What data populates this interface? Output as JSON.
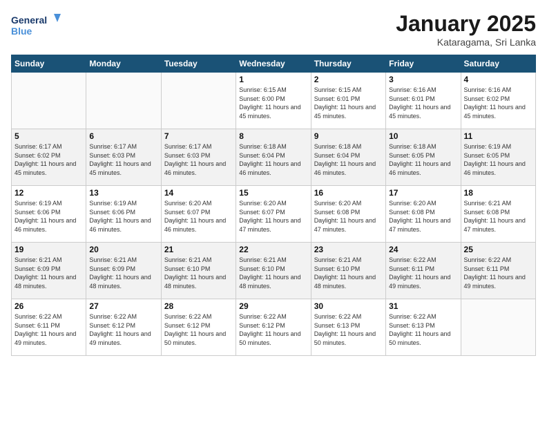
{
  "logo": {
    "line1": "General",
    "line2": "Blue"
  },
  "header": {
    "month": "January 2025",
    "location": "Kataragama, Sri Lanka"
  },
  "weekdays": [
    "Sunday",
    "Monday",
    "Tuesday",
    "Wednesday",
    "Thursday",
    "Friday",
    "Saturday"
  ],
  "weeks": [
    [
      {
        "day": "",
        "sunrise": "",
        "sunset": "",
        "daylight": ""
      },
      {
        "day": "",
        "sunrise": "",
        "sunset": "",
        "daylight": ""
      },
      {
        "day": "",
        "sunrise": "",
        "sunset": "",
        "daylight": ""
      },
      {
        "day": "1",
        "sunrise": "Sunrise: 6:15 AM",
        "sunset": "Sunset: 6:00 PM",
        "daylight": "Daylight: 11 hours and 45 minutes."
      },
      {
        "day": "2",
        "sunrise": "Sunrise: 6:15 AM",
        "sunset": "Sunset: 6:01 PM",
        "daylight": "Daylight: 11 hours and 45 minutes."
      },
      {
        "day": "3",
        "sunrise": "Sunrise: 6:16 AM",
        "sunset": "Sunset: 6:01 PM",
        "daylight": "Daylight: 11 hours and 45 minutes."
      },
      {
        "day": "4",
        "sunrise": "Sunrise: 6:16 AM",
        "sunset": "Sunset: 6:02 PM",
        "daylight": "Daylight: 11 hours and 45 minutes."
      }
    ],
    [
      {
        "day": "5",
        "sunrise": "Sunrise: 6:17 AM",
        "sunset": "Sunset: 6:02 PM",
        "daylight": "Daylight: 11 hours and 45 minutes."
      },
      {
        "day": "6",
        "sunrise": "Sunrise: 6:17 AM",
        "sunset": "Sunset: 6:03 PM",
        "daylight": "Daylight: 11 hours and 45 minutes."
      },
      {
        "day": "7",
        "sunrise": "Sunrise: 6:17 AM",
        "sunset": "Sunset: 6:03 PM",
        "daylight": "Daylight: 11 hours and 46 minutes."
      },
      {
        "day": "8",
        "sunrise": "Sunrise: 6:18 AM",
        "sunset": "Sunset: 6:04 PM",
        "daylight": "Daylight: 11 hours and 46 minutes."
      },
      {
        "day": "9",
        "sunrise": "Sunrise: 6:18 AM",
        "sunset": "Sunset: 6:04 PM",
        "daylight": "Daylight: 11 hours and 46 minutes."
      },
      {
        "day": "10",
        "sunrise": "Sunrise: 6:18 AM",
        "sunset": "Sunset: 6:05 PM",
        "daylight": "Daylight: 11 hours and 46 minutes."
      },
      {
        "day": "11",
        "sunrise": "Sunrise: 6:19 AM",
        "sunset": "Sunset: 6:05 PM",
        "daylight": "Daylight: 11 hours and 46 minutes."
      }
    ],
    [
      {
        "day": "12",
        "sunrise": "Sunrise: 6:19 AM",
        "sunset": "Sunset: 6:06 PM",
        "daylight": "Daylight: 11 hours and 46 minutes."
      },
      {
        "day": "13",
        "sunrise": "Sunrise: 6:19 AM",
        "sunset": "Sunset: 6:06 PM",
        "daylight": "Daylight: 11 hours and 46 minutes."
      },
      {
        "day": "14",
        "sunrise": "Sunrise: 6:20 AM",
        "sunset": "Sunset: 6:07 PM",
        "daylight": "Daylight: 11 hours and 46 minutes."
      },
      {
        "day": "15",
        "sunrise": "Sunrise: 6:20 AM",
        "sunset": "Sunset: 6:07 PM",
        "daylight": "Daylight: 11 hours and 47 minutes."
      },
      {
        "day": "16",
        "sunrise": "Sunrise: 6:20 AM",
        "sunset": "Sunset: 6:08 PM",
        "daylight": "Daylight: 11 hours and 47 minutes."
      },
      {
        "day": "17",
        "sunrise": "Sunrise: 6:20 AM",
        "sunset": "Sunset: 6:08 PM",
        "daylight": "Daylight: 11 hours and 47 minutes."
      },
      {
        "day": "18",
        "sunrise": "Sunrise: 6:21 AM",
        "sunset": "Sunset: 6:08 PM",
        "daylight": "Daylight: 11 hours and 47 minutes."
      }
    ],
    [
      {
        "day": "19",
        "sunrise": "Sunrise: 6:21 AM",
        "sunset": "Sunset: 6:09 PM",
        "daylight": "Daylight: 11 hours and 48 minutes."
      },
      {
        "day": "20",
        "sunrise": "Sunrise: 6:21 AM",
        "sunset": "Sunset: 6:09 PM",
        "daylight": "Daylight: 11 hours and 48 minutes."
      },
      {
        "day": "21",
        "sunrise": "Sunrise: 6:21 AM",
        "sunset": "Sunset: 6:10 PM",
        "daylight": "Daylight: 11 hours and 48 minutes."
      },
      {
        "day": "22",
        "sunrise": "Sunrise: 6:21 AM",
        "sunset": "Sunset: 6:10 PM",
        "daylight": "Daylight: 11 hours and 48 minutes."
      },
      {
        "day": "23",
        "sunrise": "Sunrise: 6:21 AM",
        "sunset": "Sunset: 6:10 PM",
        "daylight": "Daylight: 11 hours and 48 minutes."
      },
      {
        "day": "24",
        "sunrise": "Sunrise: 6:22 AM",
        "sunset": "Sunset: 6:11 PM",
        "daylight": "Daylight: 11 hours and 49 minutes."
      },
      {
        "day": "25",
        "sunrise": "Sunrise: 6:22 AM",
        "sunset": "Sunset: 6:11 PM",
        "daylight": "Daylight: 11 hours and 49 minutes."
      }
    ],
    [
      {
        "day": "26",
        "sunrise": "Sunrise: 6:22 AM",
        "sunset": "Sunset: 6:11 PM",
        "daylight": "Daylight: 11 hours and 49 minutes."
      },
      {
        "day": "27",
        "sunrise": "Sunrise: 6:22 AM",
        "sunset": "Sunset: 6:12 PM",
        "daylight": "Daylight: 11 hours and 49 minutes."
      },
      {
        "day": "28",
        "sunrise": "Sunrise: 6:22 AM",
        "sunset": "Sunset: 6:12 PM",
        "daylight": "Daylight: 11 hours and 50 minutes."
      },
      {
        "day": "29",
        "sunrise": "Sunrise: 6:22 AM",
        "sunset": "Sunset: 6:12 PM",
        "daylight": "Daylight: 11 hours and 50 minutes."
      },
      {
        "day": "30",
        "sunrise": "Sunrise: 6:22 AM",
        "sunset": "Sunset: 6:13 PM",
        "daylight": "Daylight: 11 hours and 50 minutes."
      },
      {
        "day": "31",
        "sunrise": "Sunrise: 6:22 AM",
        "sunset": "Sunset: 6:13 PM",
        "daylight": "Daylight: 11 hours and 50 minutes."
      },
      {
        "day": "",
        "sunrise": "",
        "sunset": "",
        "daylight": ""
      }
    ]
  ]
}
